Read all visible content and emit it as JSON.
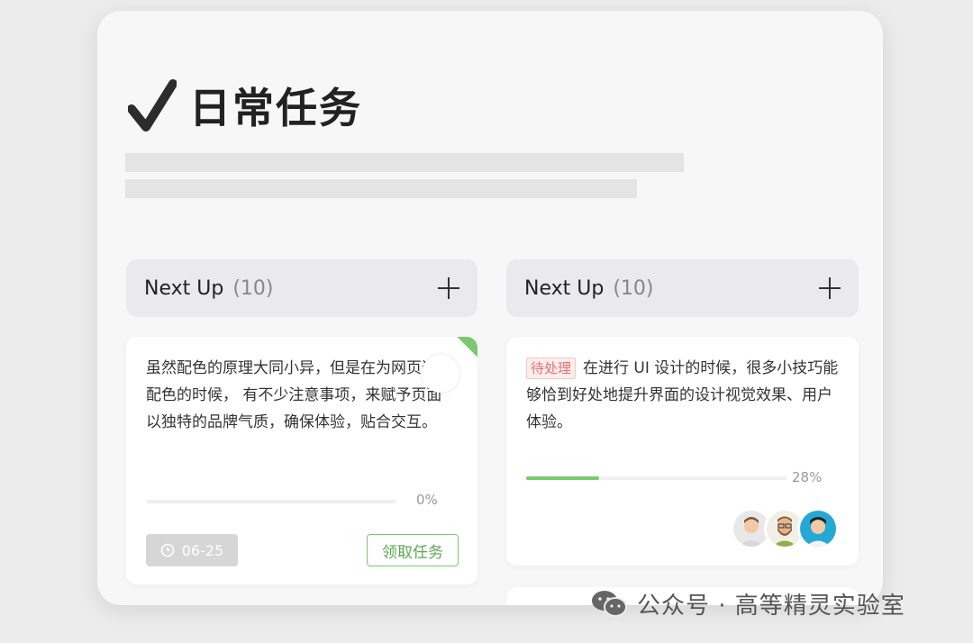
{
  "header": {
    "title": "日常任务",
    "check_icon": "checkmark-icon"
  },
  "columns": [
    {
      "title": "Next Up",
      "count": "(10)",
      "add_icon": "plus-icon"
    },
    {
      "title": "Next Up",
      "count": "(10)",
      "add_icon": "plus-icon"
    }
  ],
  "cards": [
    {
      "text": "虽然配色的原理大同小异，但是在为网页进行配色的时候， 有不少注意事项，来赋予页面以独特的品牌气质，确保体验，贴合交互。",
      "progress": 0,
      "progress_label": "0%",
      "date": "06-25",
      "date_icon": "clock-icon",
      "action_label": "领取任务",
      "accent_color": "#7bc96f"
    },
    {
      "tag": "待处理",
      "text": "在进行 UI 设计的时候，很多小技巧能够恰到好处地提升界面的设计视觉效果、用户体验。",
      "progress": 28,
      "progress_label": "28%",
      "accent_color": "#7bc96f"
    }
  ],
  "watermark": {
    "text": "公众号 · 高等精灵实验室",
    "icon": "wechat-icon"
  }
}
